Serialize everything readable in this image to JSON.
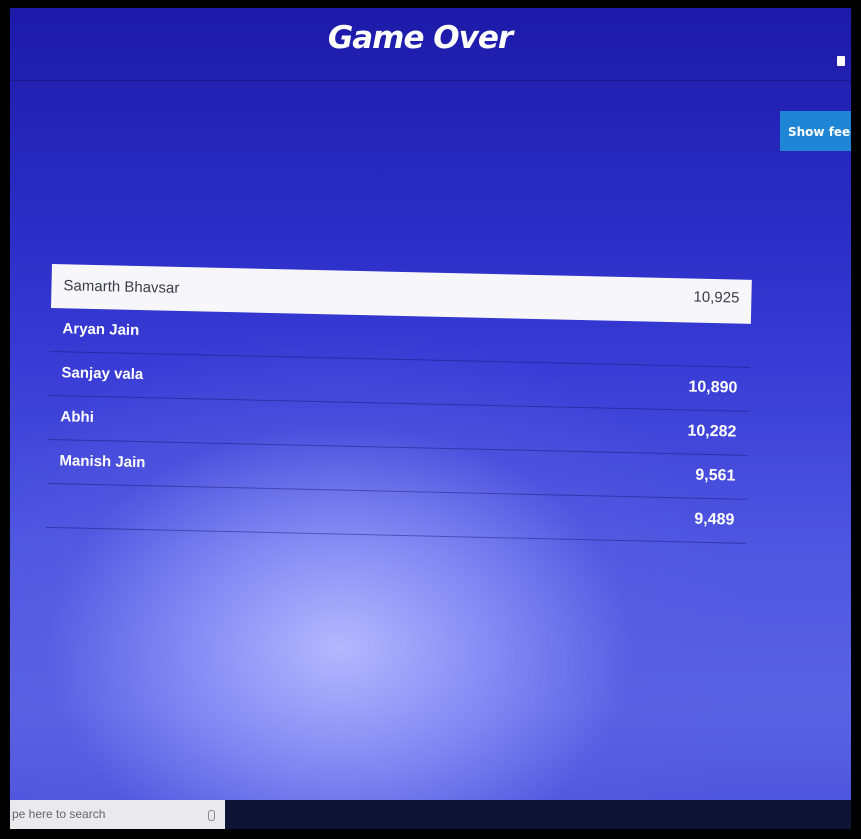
{
  "game": {
    "title": "Game Over",
    "feedback_button_label": "Show feedback"
  },
  "leaderboard": {
    "player_name_input": "Samarth Bhavsar",
    "names": [
      "Aryan Jain",
      "Sanjay vala",
      "Abhi",
      "Manish Jain"
    ],
    "scores": [
      "10,925",
      "10,890",
      "10,282",
      "9,561",
      "9,489"
    ]
  },
  "taskbar": {
    "search_placeholder": "pe here to search"
  },
  "colors": {
    "background_primary": "#2a2cc4",
    "background_glow": "#b9bcff",
    "button_blue": "#1f86d6",
    "text_light": "#ffffff"
  },
  "icons": {
    "corner": "window-icon",
    "search_mic": "microphone-icon"
  }
}
